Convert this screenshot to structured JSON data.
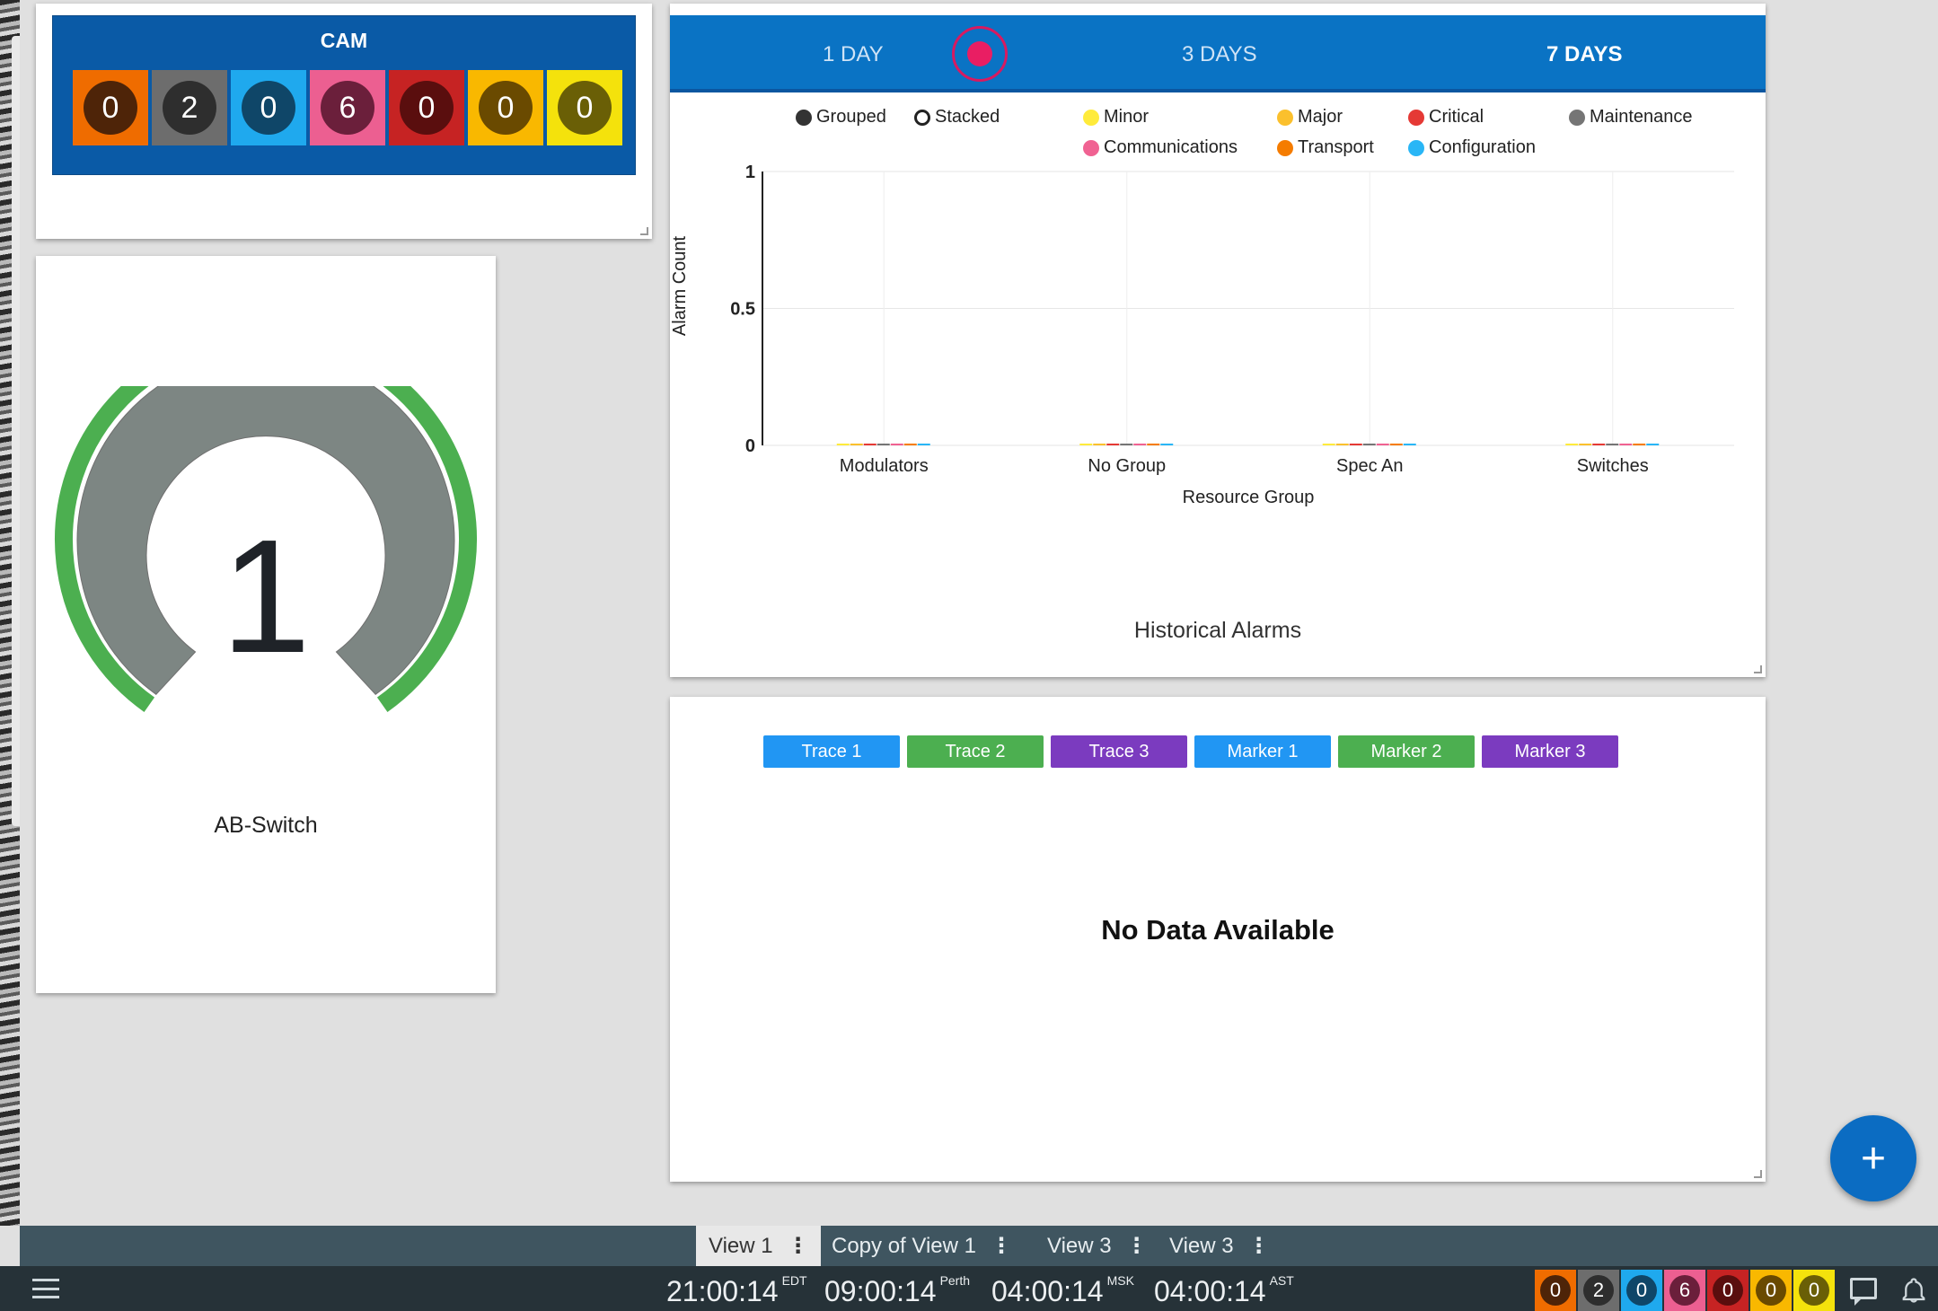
{
  "cam": {
    "title": "CAM",
    "counts": [
      {
        "value": "0",
        "box": "#ef6c00",
        "circle": "#4e2408"
      },
      {
        "value": "2",
        "box": "#6d6d6d",
        "circle": "#2e2e2e"
      },
      {
        "value": "0",
        "box": "#1fa9ee",
        "circle": "#0f4668"
      },
      {
        "value": "6",
        "box": "#ec5f91",
        "circle": "#6b1f3b"
      },
      {
        "value": "0",
        "box": "#c62323",
        "circle": "#5a0e0e"
      },
      {
        "value": "0",
        "box": "#f9b800",
        "circle": "#6a4a00"
      },
      {
        "value": "0",
        "box": "#f4e20c",
        "circle": "#6a5f06"
      }
    ]
  },
  "gauge": {
    "value": "1",
    "label": "AB-Switch",
    "fill_fraction": 1.0,
    "colors": {
      "arc": "#4caf50",
      "body": "#7d8683"
    }
  },
  "historical": {
    "ranges": [
      "1 DAY",
      "3 DAYS",
      "7 DAYS"
    ],
    "active_range": "7 DAYS",
    "mode_legend": [
      {
        "label": "Grouped",
        "style": "filled"
      },
      {
        "label": "Stacked",
        "style": "hollow"
      }
    ],
    "series_legend": [
      {
        "label": "Minor",
        "color": "#ffeb3b"
      },
      {
        "label": "Major",
        "color": "#fbc02d"
      },
      {
        "label": "Critical",
        "color": "#e53935"
      },
      {
        "label": "Maintenance",
        "color": "#757575"
      },
      {
        "label": "Communications",
        "color": "#f06292"
      },
      {
        "label": "Transport",
        "color": "#f57c00"
      },
      {
        "label": "Configuration",
        "color": "#29b6f6"
      }
    ],
    "caption": "Historical Alarms"
  },
  "chart_data": {
    "type": "bar",
    "categories": [
      "Modulators",
      "No Group",
      "Spec An",
      "Switches"
    ],
    "series": [
      {
        "name": "Minor",
        "values": [
          0,
          0,
          0,
          0
        ]
      },
      {
        "name": "Major",
        "values": [
          0,
          0,
          0,
          0
        ]
      },
      {
        "name": "Critical",
        "values": [
          0,
          0,
          0,
          0
        ]
      },
      {
        "name": "Maintenance",
        "values": [
          0,
          0,
          0,
          0
        ]
      },
      {
        "name": "Communications",
        "values": [
          0,
          0,
          0,
          0
        ]
      },
      {
        "name": "Transport",
        "values": [
          0,
          0,
          0,
          0
        ]
      },
      {
        "name": "Configuration",
        "values": [
          0,
          0,
          0,
          0
        ]
      }
    ],
    "title": "Historical Alarms",
    "xlabel": "Resource Group",
    "ylabel": "Alarm Count",
    "ylim": [
      0,
      1
    ],
    "yticks": [
      "0",
      "0.5",
      "1"
    ],
    "grid": true
  },
  "trace": {
    "buttons": [
      {
        "label": "Trace 1",
        "color": "#2196f3"
      },
      {
        "label": "Trace 2",
        "color": "#4caf50"
      },
      {
        "label": "Trace 3",
        "color": "#7b3bbf"
      },
      {
        "label": "Marker 1",
        "color": "#2196f3"
      },
      {
        "label": "Marker 2",
        "color": "#4caf50"
      },
      {
        "label": "Marker 3",
        "color": "#7b3bbf"
      }
    ],
    "empty_message": "No Data Available"
  },
  "fab": {
    "label": "+"
  },
  "views": [
    {
      "label": "View 1",
      "active": true
    },
    {
      "label": "Copy of View 1",
      "active": false
    },
    {
      "label": "View 3",
      "active": false
    },
    {
      "label": "View 3",
      "active": false
    }
  ],
  "clocks": [
    {
      "time": "21:00:14",
      "zone": "EDT"
    },
    {
      "time": "09:00:14",
      "zone": "Perth"
    },
    {
      "time": "04:00:14",
      "zone": "MSK"
    },
    {
      "time": "04:00:14",
      "zone": "AST"
    }
  ],
  "status_counts": [
    {
      "value": "0",
      "box": "#ef6c00",
      "circle": "#4e2408"
    },
    {
      "value": "2",
      "box": "#6d6d6d",
      "circle": "#2e2e2e"
    },
    {
      "value": "0",
      "box": "#1fa9ee",
      "circle": "#0f4668"
    },
    {
      "value": "6",
      "box": "#ec5f91",
      "circle": "#6b1f3b"
    },
    {
      "value": "0",
      "box": "#c62323",
      "circle": "#5a0e0e"
    },
    {
      "value": "0",
      "box": "#f9b800",
      "circle": "#6a4a00"
    },
    {
      "value": "0",
      "box": "#f4e20c",
      "circle": "#6a5f06"
    }
  ],
  "icons": {
    "menu": "hamburger-menu-icon",
    "chat": "chat-icon",
    "notifications": "bell-icon",
    "kebab": "kebab-menu-icon"
  }
}
